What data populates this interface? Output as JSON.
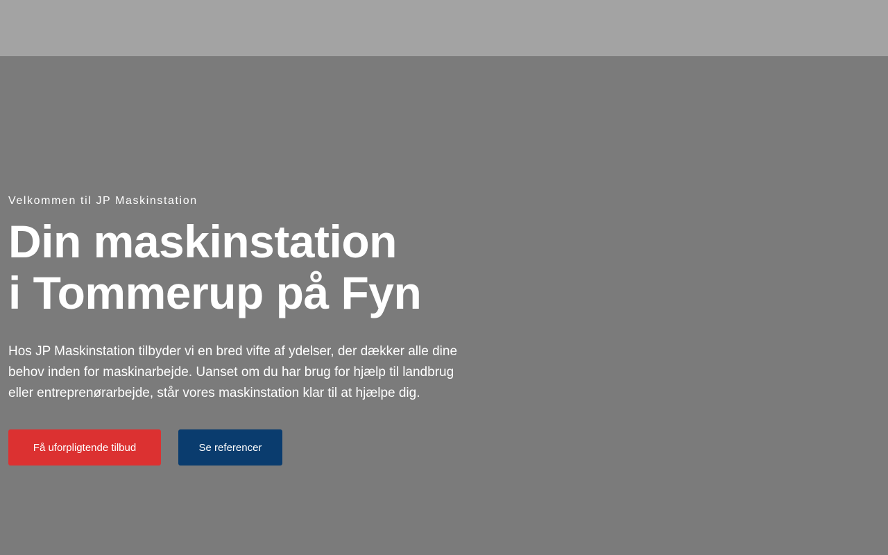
{
  "hero": {
    "eyebrow": "Velkommen til JP Maskinstation",
    "headline_line1": "Din maskinstation",
    "headline_line2": "i Tommerup på Fyn",
    "lead": "Hos JP Maskinstation tilbyder vi en bred vifte af ydelser, der dækker alle dine behov inden for maskinarbejde. Uanset om du har brug for hjælp til landbrug eller entreprenørarbejde, står vores maskinstation klar til at hjælpe dig.",
    "primary_button": "Få uforpligtende tilbud",
    "secondary_button": "Se referencer"
  },
  "colors": {
    "header_background": "#a3a3a3",
    "hero_background": "#7b7b7b",
    "primary_button": "#dc3131",
    "secondary_button": "#0a3c6e",
    "text": "#ffffff"
  }
}
